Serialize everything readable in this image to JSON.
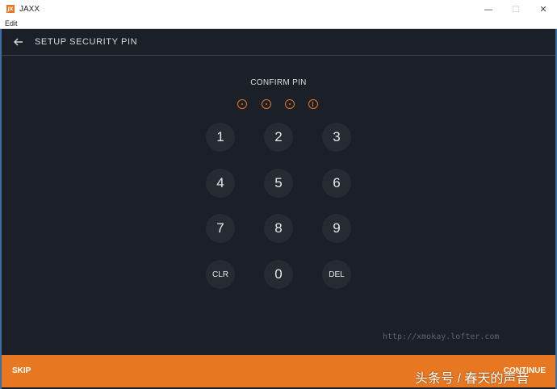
{
  "window": {
    "app_icon_text": "JX",
    "title": "JAXX",
    "controls": {
      "minimize": "—",
      "maximize": "☐",
      "close": "✕"
    }
  },
  "menubar": {
    "items": [
      "Edit"
    ]
  },
  "header": {
    "title": "SETUP SECURITY PIN",
    "back_icon": "arrow-left-icon"
  },
  "pin": {
    "title": "CONFIRM PIN",
    "digits_entered": 3,
    "length": 4
  },
  "keypad": {
    "keys": [
      "1",
      "2",
      "3",
      "4",
      "5",
      "6",
      "7",
      "8",
      "9",
      "CLR",
      "0",
      "DEL"
    ]
  },
  "watermark": "http://xmokay.lofter.com",
  "footer": {
    "skip_label": "SKIP",
    "continue_label": "CONTINUE"
  },
  "overlay_caption": "头条号 / 春天的声音",
  "colors": {
    "accent": "#e87722",
    "background": "#1b1f27",
    "key_bg": "#252a33"
  }
}
